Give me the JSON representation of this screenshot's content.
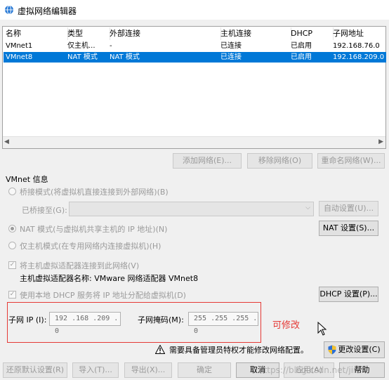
{
  "window": {
    "title": "虚拟网络编辑器"
  },
  "table": {
    "headers": [
      "名称",
      "类型",
      "外部连接",
      "主机连接",
      "DHCP",
      "子网地址"
    ],
    "rows": [
      [
        "VMnet1",
        "仅主机...",
        "-",
        "已连接",
        "已启用",
        "192.168.76.0"
      ],
      [
        "VMnet8",
        "NAT 模式",
        "NAT 模式",
        "已连接",
        "已启用",
        "192.168.209.0"
      ]
    ],
    "selected_row": 1
  },
  "net_buttons": {
    "add": "添加网络(E)...",
    "remove": "移除网络(O)",
    "rename": "重命名网络(W)..."
  },
  "vmnet_info": {
    "title": "VMnet 信息",
    "bridge_label": "桥接模式(将虚拟机直接连接到外部网络)(B)",
    "bridged_to_label": "已桥接至(G):",
    "auto_settings": "自动设置(U)...",
    "nat_label": "NAT 模式(与虚拟机共享主机的 IP 地址)(N)",
    "nat_settings": "NAT 设置(S)...",
    "hostonly_label": "仅主机模式(在专用网络内连接虚拟机)(H)",
    "connect_adapter_label": "将主机虚拟适配器连接到此网络(V)",
    "adapter_name": "主机虚拟适配器名称: VMware 网络适配器 VMnet8",
    "dhcp_label": "使用本地 DHCP 服务将 IP 地址分配给虚拟机(D)",
    "dhcp_settings": "DHCP 设置(P)...",
    "subnet_ip_label": "子网 IP (I):",
    "subnet_ip": "192 .168 .209 . 0",
    "subnet_mask_label": "子网掩码(M):",
    "subnet_mask": "255 .255 .255 . 0",
    "selected_mode": "nat",
    "connect_adapter_checked": true,
    "dhcp_checked": true
  },
  "annotation": {
    "text": "可修改",
    "color": "#e53935"
  },
  "admin": {
    "notice": "需要具备管理员特权才能修改网络配置。",
    "change_settings": "更改设置(C)"
  },
  "bottom_buttons": {
    "restore": "还原默认设置(R)",
    "import": "导入(T)...",
    "export": "导出(X)...",
    "ok": "确定",
    "cancel": "取消",
    "apply": "应用(A)",
    "help": "帮助"
  },
  "watermark": "https://blog.csdn.net/jinh",
  "colors": {
    "selection": "#0078d7",
    "disabled_text": "#9a9a9a",
    "annotation_red": "#e53935"
  }
}
